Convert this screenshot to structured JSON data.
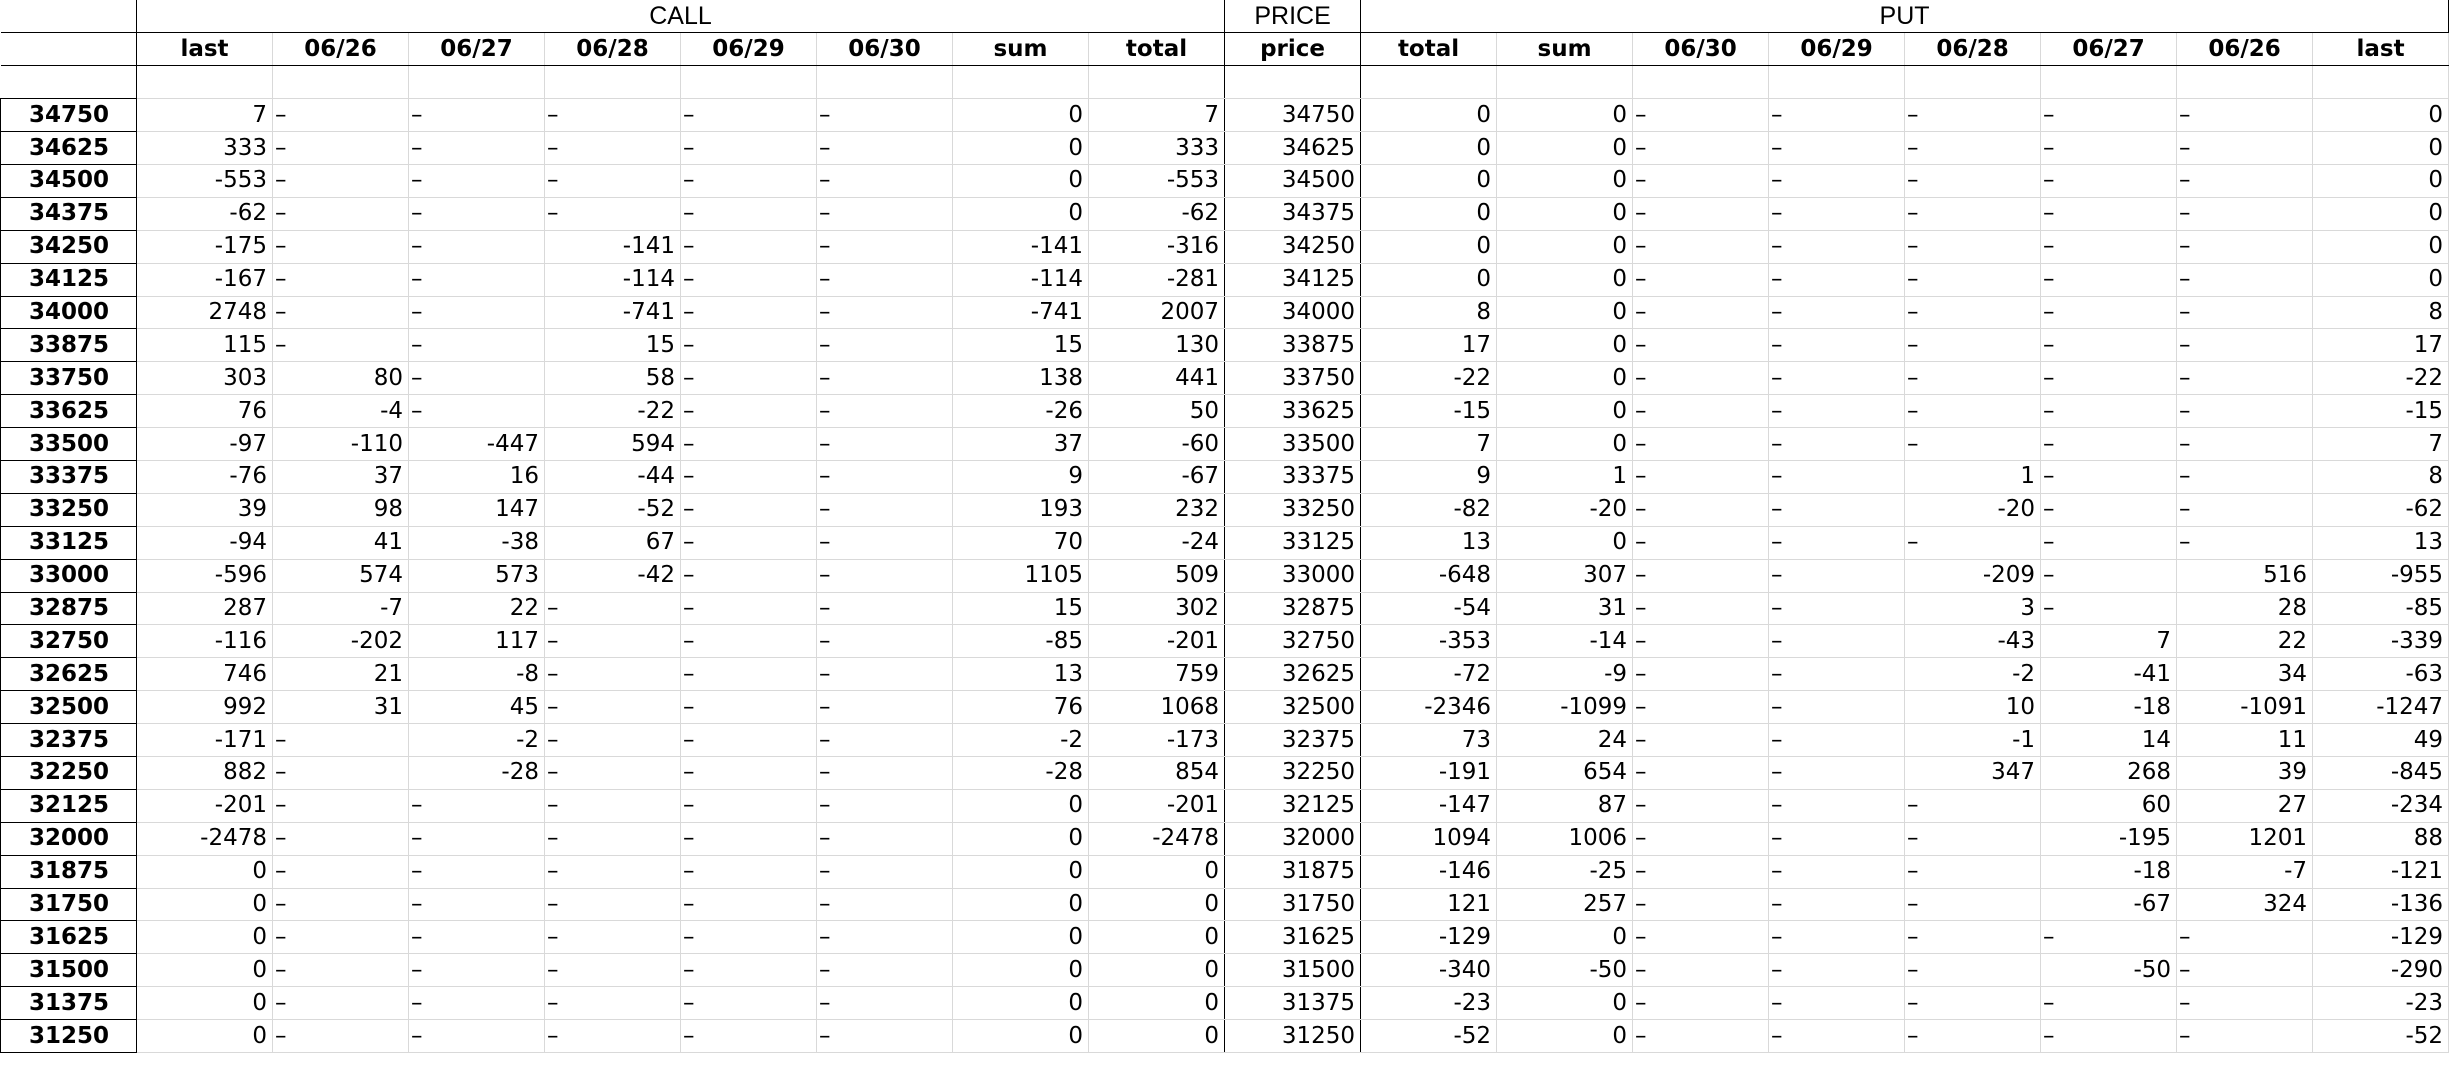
{
  "groups": {
    "call": "CALL",
    "price": "PRICE",
    "put": "PUT"
  },
  "columns": [
    "last",
    "06/26",
    "06/27",
    "06/28",
    "06/29",
    "06/30",
    "sum",
    "total",
    "price",
    "total",
    "sum",
    "06/30",
    "06/29",
    "06/28",
    "06/27",
    "06/26",
    "last"
  ],
  "rows": [
    {
      "label": "34750",
      "cells": [
        "7",
        "–",
        "–",
        "–",
        "–",
        "–",
        "0",
        "7",
        "34750",
        "0",
        "0",
        "–",
        "–",
        "–",
        "–",
        "–",
        "0"
      ]
    },
    {
      "label": "34625",
      "cells": [
        "333",
        "–",
        "–",
        "–",
        "–",
        "–",
        "0",
        "333",
        "34625",
        "0",
        "0",
        "–",
        "–",
        "–",
        "–",
        "–",
        "0"
      ]
    },
    {
      "label": "34500",
      "cells": [
        "-553",
        "–",
        "–",
        "–",
        "–",
        "–",
        "0",
        "-553",
        "34500",
        "0",
        "0",
        "–",
        "–",
        "–",
        "–",
        "–",
        "0"
      ]
    },
    {
      "label": "34375",
      "cells": [
        "-62",
        "–",
        "–",
        "–",
        "–",
        "–",
        "0",
        "-62",
        "34375",
        "0",
        "0",
        "–",
        "–",
        "–",
        "–",
        "–",
        "0"
      ]
    },
    {
      "label": "34250",
      "cells": [
        "-175",
        "–",
        "–",
        "-141",
        "–",
        "–",
        "-141",
        "-316",
        "34250",
        "0",
        "0",
        "–",
        "–",
        "–",
        "–",
        "–",
        "0"
      ]
    },
    {
      "label": "34125",
      "cells": [
        "-167",
        "–",
        "–",
        "-114",
        "–",
        "–",
        "-114",
        "-281",
        "34125",
        "0",
        "0",
        "–",
        "–",
        "–",
        "–",
        "–",
        "0"
      ]
    },
    {
      "label": "34000",
      "cells": [
        "2748",
        "–",
        "–",
        "-741",
        "–",
        "–",
        "-741",
        "2007",
        "34000",
        "8",
        "0",
        "–",
        "–",
        "–",
        "–",
        "–",
        "8"
      ]
    },
    {
      "label": "33875",
      "cells": [
        "115",
        "–",
        "–",
        "15",
        "–",
        "–",
        "15",
        "130",
        "33875",
        "17",
        "0",
        "–",
        "–",
        "–",
        "–",
        "–",
        "17"
      ]
    },
    {
      "label": "33750",
      "cells": [
        "303",
        "80",
        "–",
        "58",
        "–",
        "–",
        "138",
        "441",
        "33750",
        "-22",
        "0",
        "–",
        "–",
        "–",
        "–",
        "–",
        "-22"
      ]
    },
    {
      "label": "33625",
      "cells": [
        "76",
        "-4",
        "–",
        "-22",
        "–",
        "–",
        "-26",
        "50",
        "33625",
        "-15",
        "0",
        "–",
        "–",
        "–",
        "–",
        "–",
        "-15"
      ]
    },
    {
      "label": "33500",
      "cells": [
        "-97",
        "-110",
        "-447",
        "594",
        "–",
        "–",
        "37",
        "-60",
        "33500",
        "7",
        "0",
        "–",
        "–",
        "–",
        "–",
        "–",
        "7"
      ]
    },
    {
      "label": "33375",
      "cells": [
        "-76",
        "37",
        "16",
        "-44",
        "–",
        "–",
        "9",
        "-67",
        "33375",
        "9",
        "1",
        "–",
        "–",
        "1",
        "–",
        "–",
        "8"
      ]
    },
    {
      "label": "33250",
      "cells": [
        "39",
        "98",
        "147",
        "-52",
        "–",
        "–",
        "193",
        "232",
        "33250",
        "-82",
        "-20",
        "–",
        "–",
        "-20",
        "–",
        "–",
        "-62"
      ]
    },
    {
      "label": "33125",
      "cells": [
        "-94",
        "41",
        "-38",
        "67",
        "–",
        "–",
        "70",
        "-24",
        "33125",
        "13",
        "0",
        "–",
        "–",
        "–",
        "–",
        "–",
        "13"
      ]
    },
    {
      "label": "33000",
      "cells": [
        "-596",
        "574",
        "573",
        "-42",
        "–",
        "–",
        "1105",
        "509",
        "33000",
        "-648",
        "307",
        "–",
        "–",
        "-209",
        "–",
        "516",
        "-955"
      ]
    },
    {
      "label": "32875",
      "cells": [
        "287",
        "-7",
        "22",
        "–",
        "–",
        "–",
        "15",
        "302",
        "32875",
        "-54",
        "31",
        "–",
        "–",
        "3",
        "–",
        "28",
        "-85"
      ]
    },
    {
      "label": "32750",
      "cells": [
        "-116",
        "-202",
        "117",
        "–",
        "–",
        "–",
        "-85",
        "-201",
        "32750",
        "-353",
        "-14",
        "–",
        "–",
        "-43",
        "7",
        "22",
        "-339"
      ]
    },
    {
      "label": "32625",
      "cells": [
        "746",
        "21",
        "-8",
        "–",
        "–",
        "–",
        "13",
        "759",
        "32625",
        "-72",
        "-9",
        "–",
        "–",
        "-2",
        "-41",
        "34",
        "-63"
      ]
    },
    {
      "label": "32500",
      "cells": [
        "992",
        "31",
        "45",
        "–",
        "–",
        "–",
        "76",
        "1068",
        "32500",
        "-2346",
        "-1099",
        "–",
        "–",
        "10",
        "-18",
        "-1091",
        "-1247"
      ]
    },
    {
      "label": "32375",
      "cells": [
        "-171",
        "–",
        "-2",
        "–",
        "–",
        "–",
        "-2",
        "-173",
        "32375",
        "73",
        "24",
        "–",
        "–",
        "-1",
        "14",
        "11",
        "49"
      ]
    },
    {
      "label": "32250",
      "cells": [
        "882",
        "–",
        "-28",
        "–",
        "–",
        "–",
        "-28",
        "854",
        "32250",
        "-191",
        "654",
        "–",
        "–",
        "347",
        "268",
        "39",
        "-845"
      ]
    },
    {
      "label": "32125",
      "cells": [
        "-201",
        "–",
        "–",
        "–",
        "–",
        "–",
        "0",
        "-201",
        "32125",
        "-147",
        "87",
        "–",
        "–",
        "–",
        "60",
        "27",
        "-234"
      ]
    },
    {
      "label": "32000",
      "cells": [
        "-2478",
        "–",
        "–",
        "–",
        "–",
        "–",
        "0",
        "-2478",
        "32000",
        "1094",
        "1006",
        "–",
        "–",
        "–",
        "-195",
        "1201",
        "88"
      ]
    },
    {
      "label": "31875",
      "cells": [
        "0",
        "–",
        "–",
        "–",
        "–",
        "–",
        "0",
        "0",
        "31875",
        "-146",
        "-25",
        "–",
        "–",
        "–",
        "-18",
        "-7",
        "-121"
      ]
    },
    {
      "label": "31750",
      "cells": [
        "0",
        "–",
        "–",
        "–",
        "–",
        "–",
        "0",
        "0",
        "31750",
        "121",
        "257",
        "–",
        "–",
        "–",
        "-67",
        "324",
        "-136"
      ]
    },
    {
      "label": "31625",
      "cells": [
        "0",
        "–",
        "–",
        "–",
        "–",
        "–",
        "0",
        "0",
        "31625",
        "-129",
        "0",
        "–",
        "–",
        "–",
        "–",
        "–",
        "-129"
      ]
    },
    {
      "label": "31500",
      "cells": [
        "0",
        "–",
        "–",
        "–",
        "–",
        "–",
        "0",
        "0",
        "31500",
        "-340",
        "-50",
        "–",
        "–",
        "–",
        "-50",
        "–",
        "-290"
      ]
    },
    {
      "label": "31375",
      "cells": [
        "0",
        "–",
        "–",
        "–",
        "–",
        "–",
        "0",
        "0",
        "31375",
        "-23",
        "0",
        "–",
        "–",
        "–",
        "–",
        "–",
        "-23"
      ]
    },
    {
      "label": "31250",
      "cells": [
        "0",
        "–",
        "–",
        "–",
        "–",
        "–",
        "0",
        "0",
        "31250",
        "-52",
        "0",
        "–",
        "–",
        "–",
        "–",
        "–",
        "-52"
      ]
    }
  ]
}
